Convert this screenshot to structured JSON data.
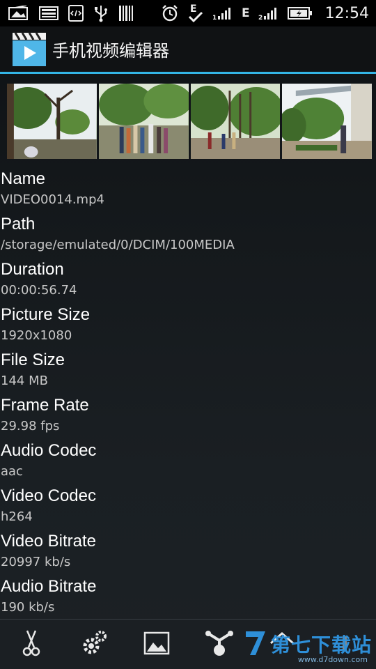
{
  "status_bar": {
    "time": "12:54",
    "network_type_1": "E",
    "network_type_2": "E",
    "icons": [
      "image-icon",
      "gallery-icon",
      "code-icon",
      "usb-icon",
      "barcode-icon",
      "alarm-icon",
      "data-check-icon",
      "signal-1-icon",
      "signal-2-icon",
      "battery-charging-icon"
    ]
  },
  "action_bar": {
    "title": "手机视频编辑器",
    "accent_color": "#33b5e5"
  },
  "thumbnails": {
    "count": 4,
    "icons": [
      "video-frame-1",
      "video-frame-2",
      "video-frame-3",
      "video-frame-4"
    ]
  },
  "info": [
    {
      "label": "Name",
      "value": "VIDEO0014.mp4"
    },
    {
      "label": "Path",
      "value": "/storage/emulated/0/DCIM/100MEDIA"
    },
    {
      "label": "Duration",
      "value": "00:00:56.74"
    },
    {
      "label": "Picture Size",
      "value": "1920x1080"
    },
    {
      "label": "File Size",
      "value": "144 MB"
    },
    {
      "label": "Frame Rate",
      "value": "29.98 fps"
    },
    {
      "label": "Audio Codec",
      "value": "aac"
    },
    {
      "label": "Video Codec",
      "value": "h264"
    },
    {
      "label": "Video Bitrate",
      "value": "20997 kb/s"
    },
    {
      "label": "Audio Bitrate",
      "value": "190 kb/s"
    }
  ],
  "toolbar": {
    "icons": [
      "scissors-icon",
      "settings-icon",
      "image-icon",
      "share-icon",
      "home-icon",
      "more-icon"
    ]
  },
  "watermark": {
    "text": "第七下载站",
    "url": "www.d7down.com"
  }
}
